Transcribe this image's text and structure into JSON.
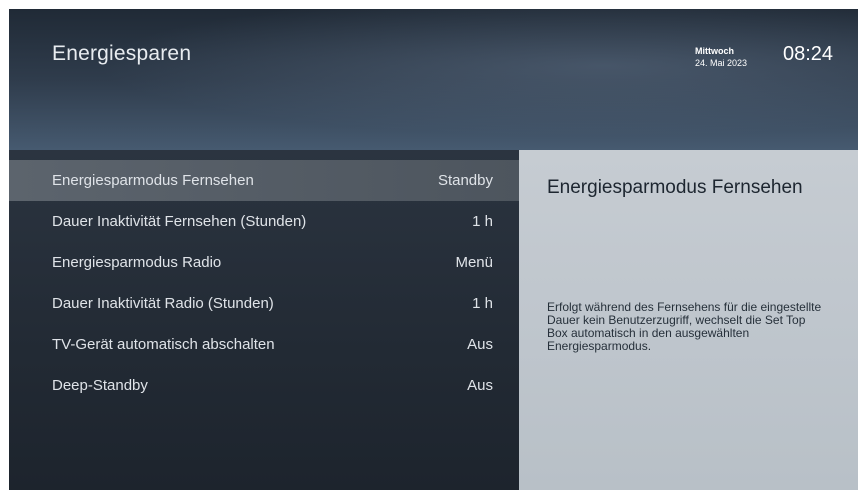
{
  "header": {
    "title": "Energiesparen",
    "weekday": "Mittwoch",
    "date": "24. Mai 2023",
    "time": "08:24"
  },
  "settings": [
    {
      "label": "Energiesparmodus Fernsehen",
      "value": "Standby",
      "selected": true
    },
    {
      "label": "Dauer Inaktivität Fernsehen (Stunden)",
      "value": "1 h"
    },
    {
      "label": "Energiesparmodus Radio",
      "value": "Menü"
    },
    {
      "label": "Dauer Inaktivität Radio (Stunden)",
      "value": "1 h"
    },
    {
      "label": "TV-Gerät automatisch abschalten",
      "value": "Aus"
    },
    {
      "label": "Deep-Standby",
      "value": "Aus"
    }
  ],
  "detail": {
    "title": "Energiesparmodus Fernsehen",
    "description": "Erfolgt während des Fernsehens für die eingestellte Dauer kein Benutzerzugriff, wechselt die Set Top Box automatisch in den ausgewählten Energiesparmodus."
  },
  "colors": {
    "selected_row": "#5c646d",
    "detail_panel": "#c6ccd2",
    "text_light": "#dfe3e8",
    "text_dark": "#1d2630"
  }
}
